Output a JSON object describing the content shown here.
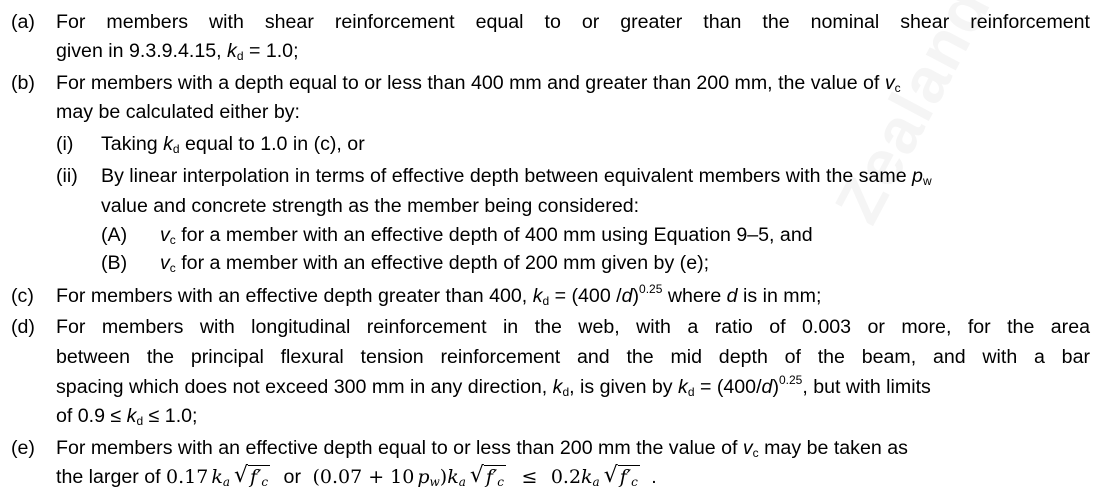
{
  "watermark": "Zealand *",
  "items": {
    "a": {
      "label": "(a)",
      "line1": "For members with shear reinforcement equal to or greater than the nominal shear reinforcement",
      "line2_pre": "given in 9.3.9.4.15, ",
      "line2_sym": "k",
      "line2_sub": "d",
      "line2_post": " = 1.0;"
    },
    "b": {
      "label": "(b)",
      "line1_pre": "For members with a depth equal to or less than 400 mm and greater than 200 mm, the value of ",
      "line1_sym": "v",
      "line1_sub": "c",
      "line2": "may be calculated either by:",
      "i": {
        "label": "(i)",
        "pre": "Taking ",
        "sym": "k",
        "sub": "d",
        "post": " equal to 1.0 in (c), or"
      },
      "ii": {
        "label": "(ii)",
        "line1_pre": "By linear interpolation in terms of effective depth between equivalent members with the same ",
        "line1_sym": "p",
        "line1_sub": "w",
        "line2": "value and concrete strength as the member being considered:",
        "A": {
          "label": "(A)",
          "sym": "v",
          "sub": "c",
          "text": " for a member with an effective depth of 400 mm using Equation 9–5, and"
        },
        "B": {
          "label": "(B)",
          "sym": "v",
          "sub": "c",
          "text": " for a member with an effective depth of 200 mm given by (e);"
        }
      }
    },
    "c": {
      "label": "(c)",
      "pre": "For members with an effective depth greater than 400, ",
      "sym": "k",
      "sub": "d",
      "mid": " = (400 /",
      "d": "d",
      "close": ")",
      "exp": "0.25",
      "post": " where ",
      "d2": "d",
      "end": " is in mm;"
    },
    "d": {
      "label": "(d)",
      "line1": "For members with longitudinal reinforcement in the web, with a ratio of 0.003 or more, for the area",
      "line2": "between the principal flexural tension reinforcement and the mid depth of the beam, and with a bar",
      "line3_pre": "spacing which does not exceed 300 mm in any direction, ",
      "line3_sym": "k",
      "line3_sub": "d",
      "line3_mid": ", is given by ",
      "line3_sym2": "k",
      "line3_sub2": "d",
      "line3_eq": " = (400/",
      "line3_d": "d",
      "line3_close": ")",
      "line3_exp": "0.25",
      "line3_post": ", but with limits",
      "line4_pre": "of 0.9 ≤ ",
      "line4_sym": "k",
      "line4_sub": "d",
      "line4_post": " ≤ 1.0;"
    },
    "e": {
      "label": "(e)",
      "line1_pre": "For members with an effective depth equal to or less than 200 mm the value of ",
      "line1_sym": "v",
      "line1_sub": "c",
      "line1_post": " may be taken as",
      "line2_pre": "the larger of ",
      "f1_coef": "0.17",
      "f1_k": "k",
      "f1_ksub": "a",
      "f_root": "f′",
      "f_rootsub": "c",
      "or": "or",
      "f2_open": "(0.07 + 10",
      "f2_p": "p",
      "f2_psub": "w",
      "f2_close": ")",
      "f2_k": "k",
      "f2_ksub": "a",
      "le": "≤",
      "f3_coef": "0.2",
      "f3_k": "k",
      "f3_ksub": "a",
      "end": "."
    }
  }
}
